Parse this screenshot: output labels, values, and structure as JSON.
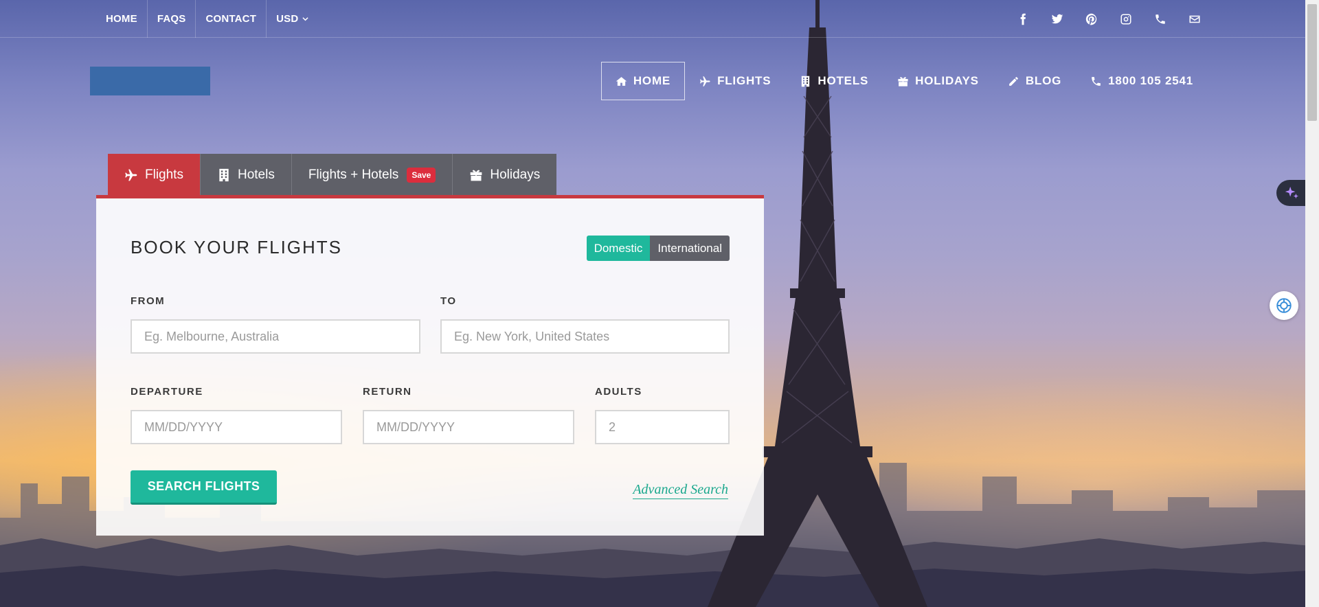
{
  "topbar": {
    "links": [
      "HOME",
      "FAQS",
      "CONTACT",
      "USD"
    ],
    "social_icons": [
      "facebook-icon",
      "twitter-icon",
      "pinterest-icon",
      "instagram-icon",
      "phone-icon",
      "envelope-icon"
    ]
  },
  "nav": {
    "items": [
      {
        "label": "HOME",
        "icon": "home-icon"
      },
      {
        "label": "FLIGHTS",
        "icon": "plane-icon"
      },
      {
        "label": "HOTELS",
        "icon": "building-icon"
      },
      {
        "label": "HOLIDAYS",
        "icon": "gift-icon"
      },
      {
        "label": "BLOG",
        "icon": "pencil-icon"
      },
      {
        "label": "1800 105 2541",
        "icon": "phone-icon"
      }
    ],
    "active": "HOME"
  },
  "booking": {
    "tabs": [
      {
        "label": "Flights",
        "icon": "plane-icon"
      },
      {
        "label": "Hotels",
        "icon": "building-icon"
      },
      {
        "label": "Flights + Hotels",
        "badge": "Save"
      },
      {
        "label": "Holidays",
        "icon": "gift-icon"
      }
    ],
    "active_tab": "Flights",
    "title": "BOOK YOUR FLIGHTS",
    "trip_type": {
      "domestic": "Domestic",
      "international": "International",
      "selected": "Domestic"
    },
    "from": {
      "label": "FROM",
      "placeholder": "Eg. Melbourne, Australia"
    },
    "to": {
      "label": "TO",
      "placeholder": "Eg. New York, United States"
    },
    "departure": {
      "label": "DEPARTURE",
      "placeholder": "MM/DD/YYYY"
    },
    "return": {
      "label": "RETURN",
      "placeholder": "MM/DD/YYYY"
    },
    "adults": {
      "label": "ADULTS",
      "placeholder": "2"
    },
    "search_button": "SEARCH FLIGHTS",
    "advanced_link": "Advanced Search"
  },
  "colors": {
    "accent_red": "#c8393f",
    "accent_green": "#1fb89c",
    "tab_gray": "#5f6068"
  }
}
